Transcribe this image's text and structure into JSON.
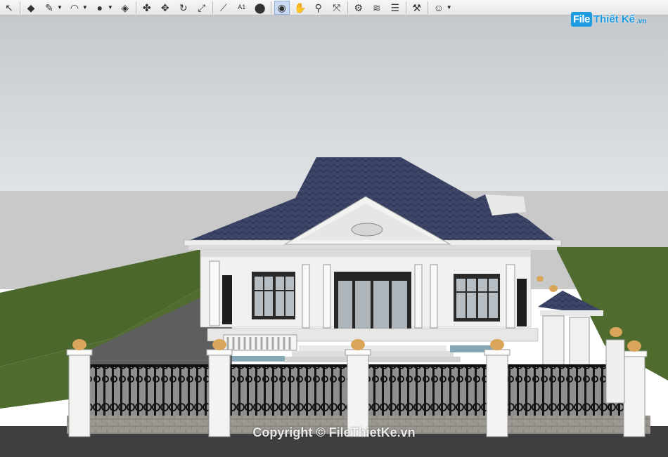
{
  "toolbar": {
    "tools": [
      {
        "name": "select-tool",
        "glyph": "↖"
      },
      {
        "name": "eraser-tool",
        "glyph": "◆"
      },
      {
        "name": "line-tool",
        "glyph": "✎"
      },
      {
        "name": "arc-tool",
        "glyph": "◠"
      },
      {
        "name": "shape-tool",
        "glyph": "●"
      },
      {
        "name": "push-pull-tool",
        "glyph": "◈"
      },
      {
        "name": "follow-me-tool",
        "glyph": "✤"
      },
      {
        "name": "move-tool",
        "glyph": "✥"
      },
      {
        "name": "rotate-tool",
        "glyph": "↻"
      },
      {
        "name": "scale-tool",
        "glyph": "⤢"
      },
      {
        "name": "tape-measure-tool",
        "glyph": "⟋"
      },
      {
        "name": "text-tool",
        "glyph": "A1"
      },
      {
        "name": "paint-bucket-tool",
        "glyph": "⬤"
      },
      {
        "name": "orbit-tool",
        "glyph": "◉"
      },
      {
        "name": "pan-tool",
        "glyph": "✋"
      },
      {
        "name": "zoom-tool",
        "glyph": "⚲"
      },
      {
        "name": "zoom-extents-tool",
        "glyph": "⤧"
      },
      {
        "name": "3d-warehouse-tool",
        "glyph": "⚙"
      },
      {
        "name": "sandbox-tool",
        "glyph": "≋"
      },
      {
        "name": "layers-tool",
        "glyph": "☰"
      },
      {
        "name": "extension-tool",
        "glyph": "⚒"
      },
      {
        "name": "account-tool",
        "glyph": "☺"
      }
    ]
  },
  "logo": {
    "box": "File",
    "text": "Thiết Kế",
    "tld": ".vn"
  },
  "watermark": "Copyright © FileThietKe.vn",
  "colors": {
    "sky_top": "#c8cdd1",
    "sky_bottom": "#dfe2e4",
    "grass": "#4f6b2e",
    "road": "#5a5a5a",
    "roof": "#3d4569",
    "wall": "#f3f4f2",
    "fence": "#1c1c1c",
    "pillar_lamp": "#d9a55a"
  }
}
